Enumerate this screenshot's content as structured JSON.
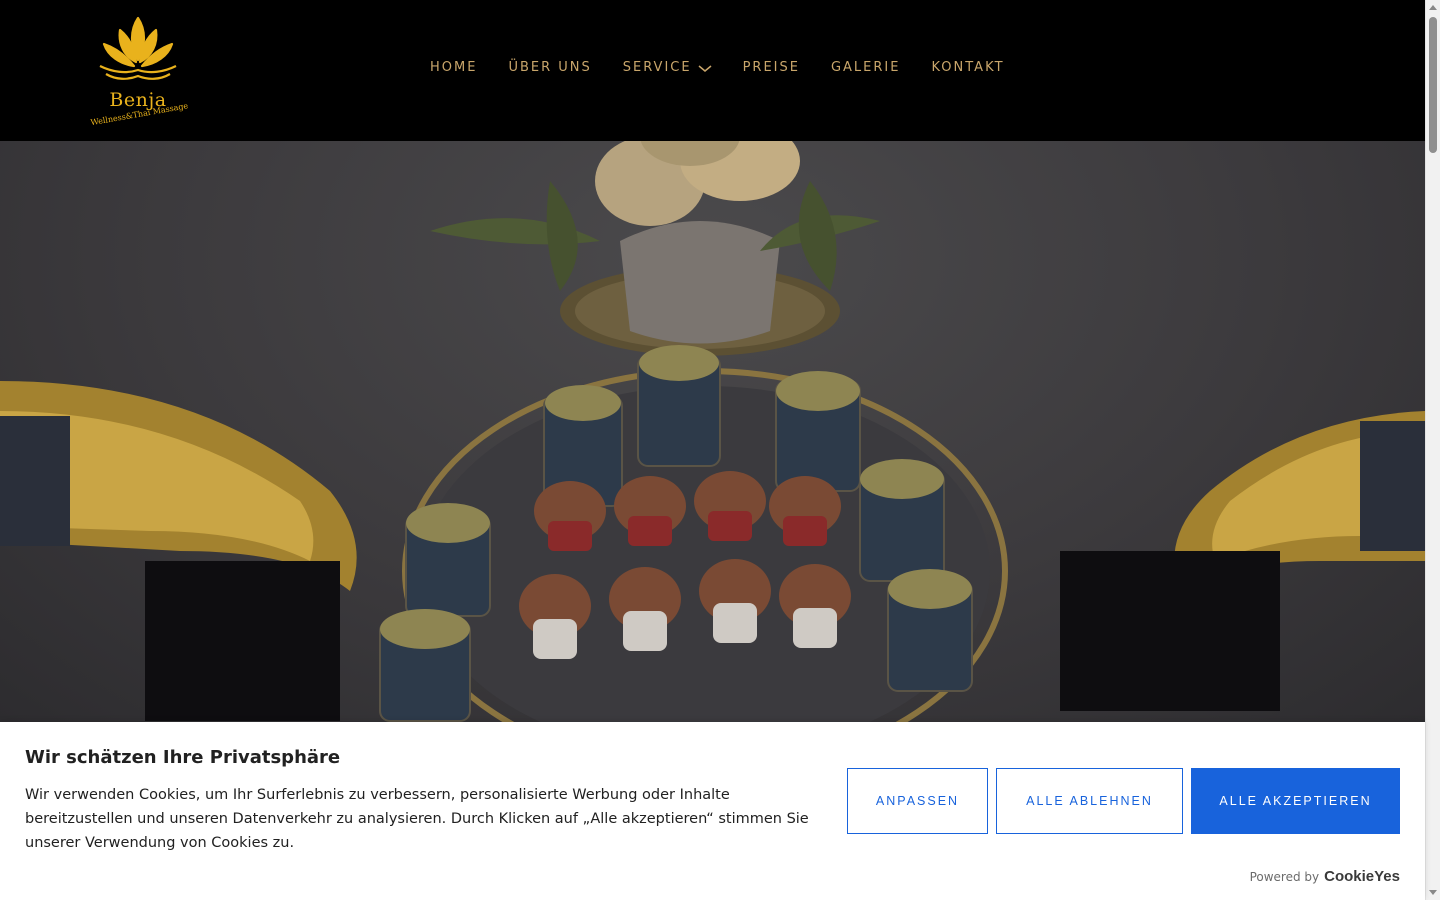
{
  "header": {
    "logo": {
      "name": "Benja",
      "tagline": "Wellness&Thai Massage",
      "accent": "#e9b21c"
    },
    "nav": [
      {
        "label": "HOME"
      },
      {
        "label": "ÜBER UNS"
      },
      {
        "label": "SERVICE",
        "has_dropdown": true
      },
      {
        "label": "PREISE"
      },
      {
        "label": "GALERIE"
      },
      {
        "label": "KONTAKT"
      }
    ],
    "nav_color": "#c9a66b"
  },
  "cookie_banner": {
    "title": "Wir schätzen Ihre Privatsphäre",
    "text": "Wir verwenden Cookies, um Ihr Surferlebnis zu verbessern, personalisierte Werbung oder Inhalte bereitzustellen und unseren Datenverkehr zu analysieren. Durch Klicken auf „Alle akzeptieren“ stimmen Sie unserer Verwendung von Cookies zu.",
    "customize_label": "ANPASSEN",
    "reject_label": "ALLE ABLEHNEN",
    "accept_label": "ALLE AKZEPTIEREN",
    "powered_by": "Powered by",
    "brand": "CookieYes",
    "accent": "#1863dc"
  }
}
